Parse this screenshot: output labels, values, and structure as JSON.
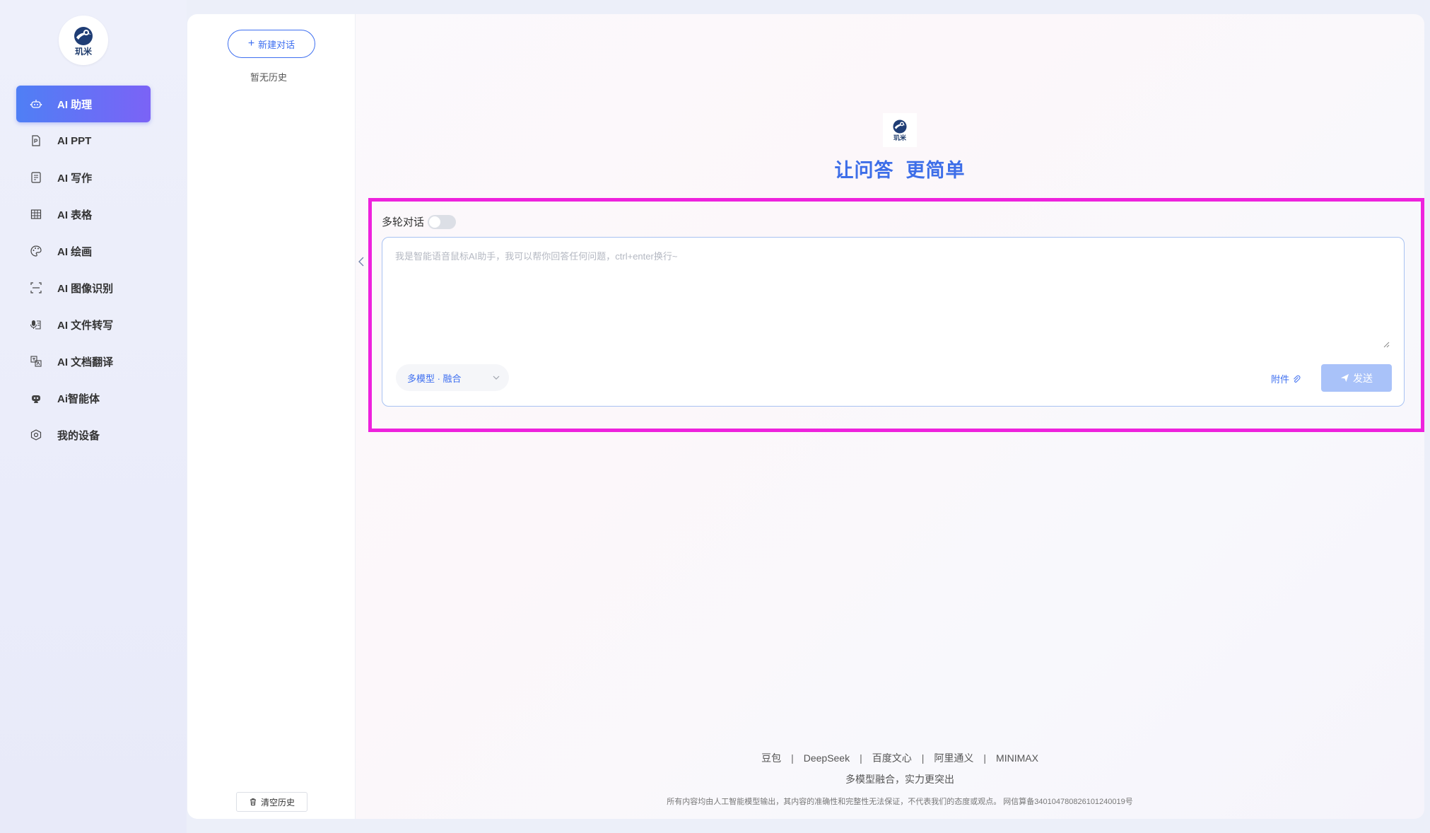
{
  "brand": {
    "logo_text": "玑米"
  },
  "nav": {
    "items": [
      {
        "label": "AI 助理",
        "icon": "robot-icon",
        "active": true
      },
      {
        "label": "AI PPT",
        "icon": "ppt-file-icon",
        "active": false
      },
      {
        "label": "AI 写作",
        "icon": "document-icon",
        "active": false
      },
      {
        "label": "AI 表格",
        "icon": "table-icon",
        "active": false
      },
      {
        "label": "AI 绘画",
        "icon": "palette-icon",
        "active": false
      },
      {
        "label": "AI 图像识别",
        "icon": "ocr-scan-icon",
        "active": false
      },
      {
        "label": "AI 文件转写",
        "icon": "microphone-file-icon",
        "active": false
      },
      {
        "label": "AI 文档翻译",
        "icon": "translate-icon",
        "active": false
      },
      {
        "label": "Ai智能体",
        "icon": "agent-icon",
        "active": false
      },
      {
        "label": "我的设备",
        "icon": "device-icon",
        "active": false
      }
    ]
  },
  "history": {
    "new_chat_label": "新建对话",
    "empty_label": "暂无历史",
    "clear_label": "清空历史"
  },
  "main": {
    "hero_title": "让问答  更简单",
    "multi_turn_label": "多轮对话",
    "multi_turn_enabled": false,
    "input_placeholder": "我是智能语音鼠标AI助手，我可以帮你回答任何问题，ctrl+enter换行~",
    "model_select_value": "多模型 · 融合",
    "attach_label": "附件",
    "send_label": "发送"
  },
  "footer": {
    "models": [
      "豆包",
      "DeepSeek",
      "百度文心",
      "阿里通义",
      "MINIMAX"
    ],
    "separator": "|",
    "tagline": "多模型融合，实力更突出",
    "disclaimer": "所有内容均由人工智能模型输出，其内容的准确性和完整性无法保证，不代表我们的态度或观点。 网信算备340104780826101240019号"
  },
  "colors": {
    "accent": "#3e6ff0",
    "nav_active_start": "#4f7ff5",
    "nav_active_end": "#7b63f6",
    "send_disabled": "#a9c2f9",
    "highlight": "#ee22dd"
  }
}
